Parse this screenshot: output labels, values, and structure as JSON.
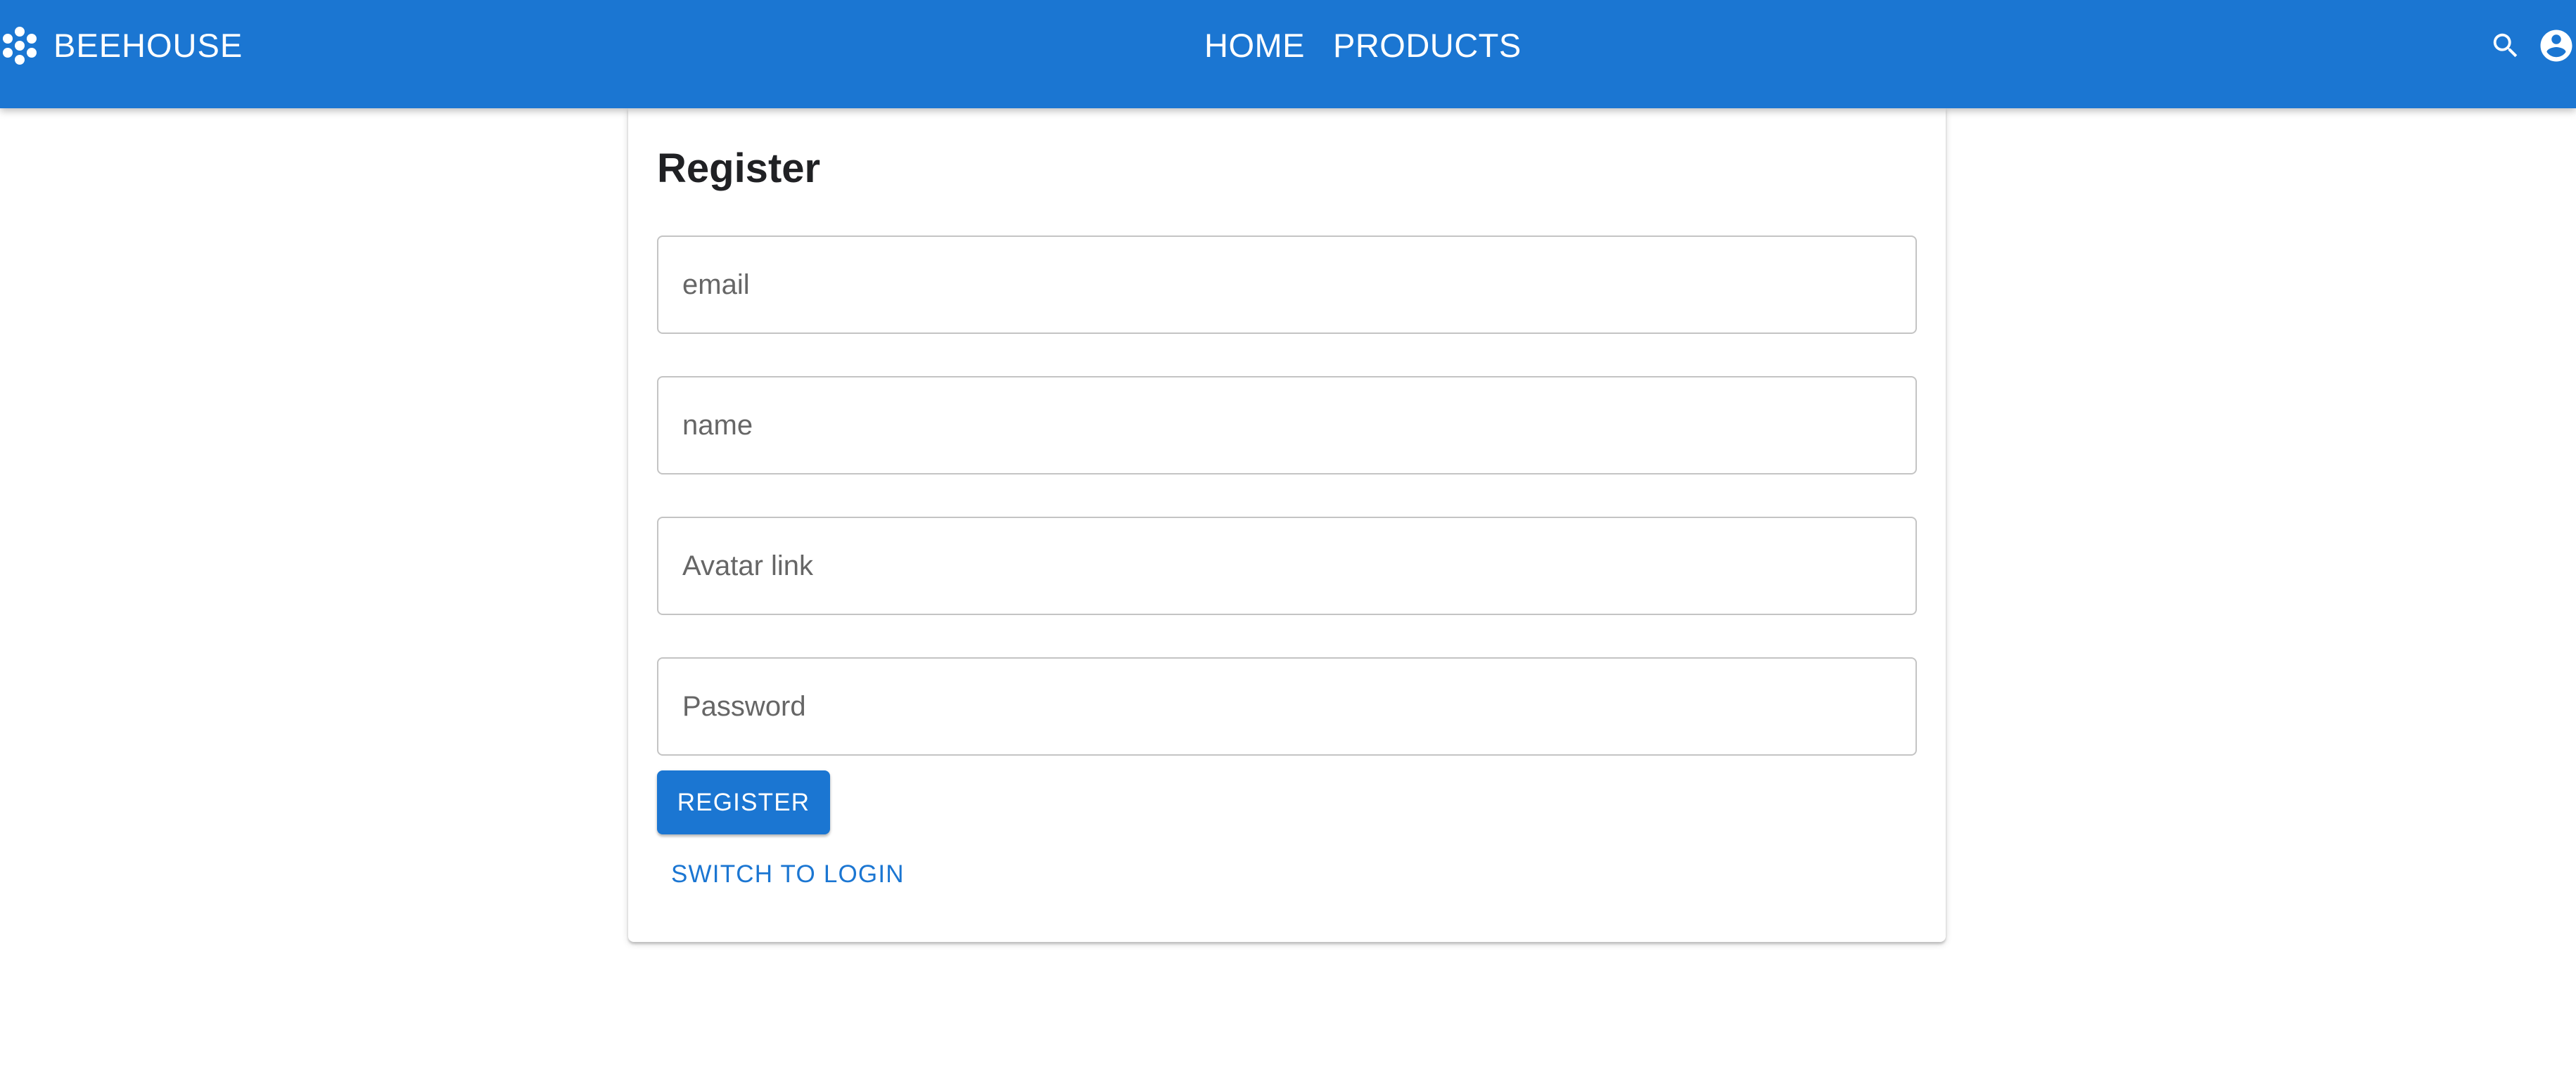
{
  "appbar": {
    "brand_icon": "honeycomb-icon",
    "brand_name": "BEEHOUSE",
    "nav": [
      {
        "label": "HOME"
      },
      {
        "label": "PRODUCTS"
      }
    ],
    "icons": [
      "search-icon",
      "account-circle-icon"
    ],
    "color": "#1b76d2"
  },
  "register": {
    "title": "Register",
    "fields": {
      "email": {
        "placeholder": "email",
        "value": ""
      },
      "name": {
        "placeholder": "name",
        "value": ""
      },
      "avatar": {
        "placeholder": "Avatar link",
        "value": ""
      },
      "password": {
        "placeholder": "Password",
        "value": ""
      }
    },
    "submit_label": "REGISTER",
    "switch_label": "SWITCH TO LOGIN"
  }
}
